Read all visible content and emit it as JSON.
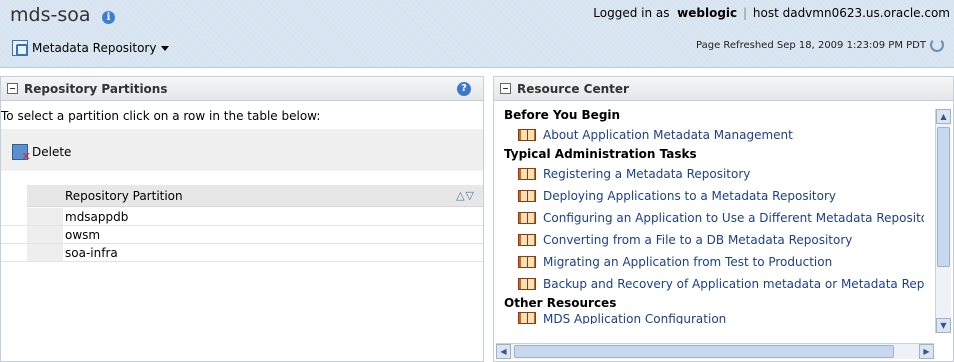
{
  "header": {
    "app_name": "mds-soa",
    "info_glyph": "i",
    "menu_label": "Metadata Repository",
    "login_prefix": "Logged in as",
    "user": "weblogic",
    "separator": "|",
    "host_label": "host dadvmn0623.us.oracle.com",
    "refreshed": "Page Refreshed Sep 18, 2009 1:23:09 PM PDT"
  },
  "partitions_panel": {
    "title": "Repository Partitions",
    "help_glyph": "?",
    "instruction": "To select a partition click on a row in the table below:",
    "delete_label": "Delete",
    "column_header": "Repository Partition",
    "sort_glyphs": "△▽",
    "rows": [
      {
        "name": "mdsappdb"
      },
      {
        "name": "owsm"
      },
      {
        "name": "soa-infra"
      }
    ]
  },
  "resource_center": {
    "title": "Resource Center",
    "sections": [
      {
        "heading": "Before You Begin",
        "links": [
          "About Application Metadata Management"
        ]
      },
      {
        "heading": "Typical Administration Tasks",
        "links": [
          "Registering a Metadata Repository",
          "Deploying Applications to a Metadata Repository",
          "Configuring an Application to Use a Different Metadata Repository",
          "Converting from a File to a DB Metadata Repository",
          "Migrating an Application from Test to Production",
          "Backup and Recovery of Application metadata or Metadata Repository"
        ]
      },
      {
        "heading": "Other Resources",
        "links": [
          "MDS Application Configuration"
        ]
      }
    ]
  },
  "colors": {
    "header_bg": "#d7e3f1",
    "link": "#1c3f8f",
    "accent_blue": "#3d7fcf"
  }
}
